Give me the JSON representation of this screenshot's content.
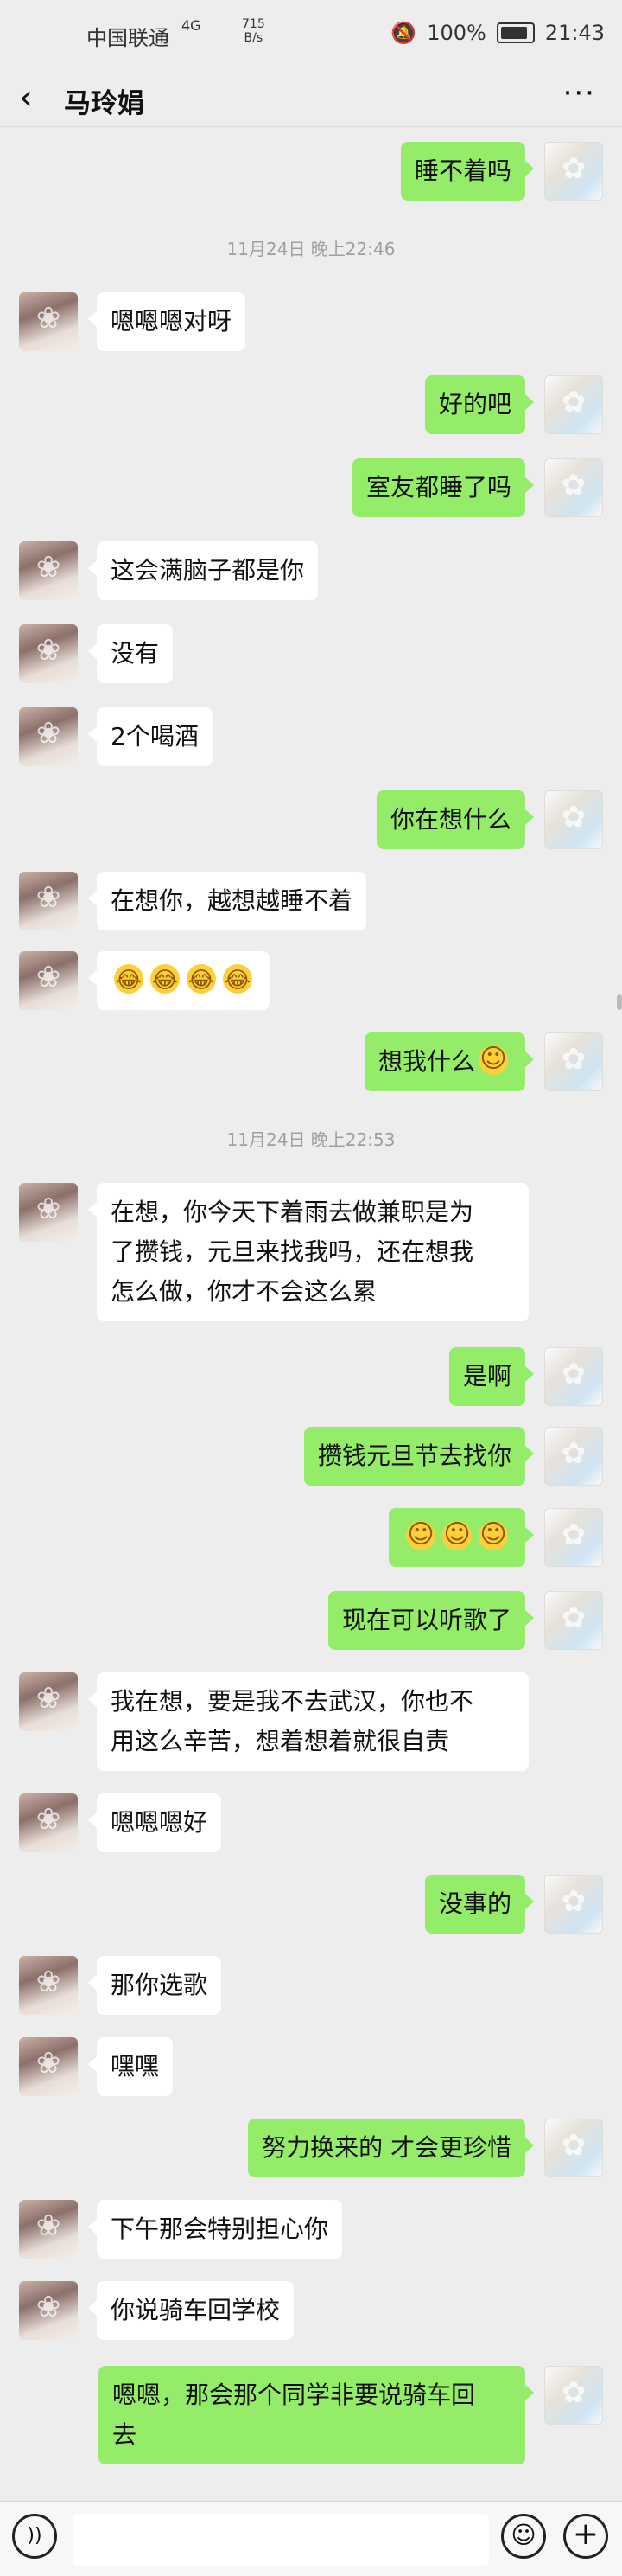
{
  "status_bar": {
    "carrier": "中国联通",
    "network": "4G",
    "rate_value": "715",
    "rate_unit": "B/s",
    "battery": "100%",
    "time": "21:43"
  },
  "header": {
    "back_icon": "‹",
    "title": "马玲娟",
    "more_icon": "···"
  },
  "timestamps": {
    "t1": "11月24日 晚上22:46",
    "t2": "11月24日 晚上22:53"
  },
  "messages": [
    {
      "id": "m01",
      "text": "睡不着吗"
    },
    {
      "id": "m02",
      "text": "嗯嗯嗯对呀"
    },
    {
      "id": "m03",
      "text": "好的吧"
    },
    {
      "id": "m04",
      "text": "室友都睡了吗"
    },
    {
      "id": "m05",
      "text": "这会满脑子都是你"
    },
    {
      "id": "m06",
      "text": "没有"
    },
    {
      "id": "m07",
      "text": "2个喝酒"
    },
    {
      "id": "m08",
      "text": "你在想什么"
    },
    {
      "id": "m09",
      "text": "在想你，越想越睡不着"
    },
    {
      "id": "m10",
      "text": ""
    },
    {
      "id": "m11",
      "text": "想我什么"
    },
    {
      "id": "m12_line1",
      "text": "在想，你今天下着雨去做兼职是为"
    },
    {
      "id": "m12_line2",
      "text": "了攒钱，元旦来找我吗，还在想我"
    },
    {
      "id": "m12_line3",
      "text": "怎么做，你才不会这么累"
    },
    {
      "id": "m13",
      "text": "是啊"
    },
    {
      "id": "m14",
      "text": "攒钱元旦节去找你"
    },
    {
      "id": "m15",
      "text": ""
    },
    {
      "id": "m16",
      "text": "现在可以听歌了"
    },
    {
      "id": "m17_line1",
      "text": "我在想，要是我不去武汉，你也不"
    },
    {
      "id": "m17_line2",
      "text": "用这么辛苦，想着想着就很自责"
    },
    {
      "id": "m18",
      "text": "嗯嗯嗯好"
    },
    {
      "id": "m19",
      "text": "没事的"
    },
    {
      "id": "m20",
      "text": "那你选歌"
    },
    {
      "id": "m21",
      "text": "嘿嘿"
    },
    {
      "id": "m22",
      "text": "努力换来的 才会更珍惜"
    },
    {
      "id": "m23",
      "text": "下午那会特别担心你"
    },
    {
      "id": "m24",
      "text": "你说骑车回学校"
    },
    {
      "id": "m25_line1",
      "text": "嗯嗯，那会那个同学非要说骑车回"
    },
    {
      "id": "m25_line2",
      "text": "去"
    }
  ],
  "colors": {
    "outgoing_bubble": "#95ec69",
    "incoming_bubble": "#ffffff",
    "background": "#ededed"
  },
  "input_bar": {
    "voice_icon": "voice-icon",
    "emoji_icon": "emoji-icon",
    "plus_icon": "plus-icon"
  }
}
